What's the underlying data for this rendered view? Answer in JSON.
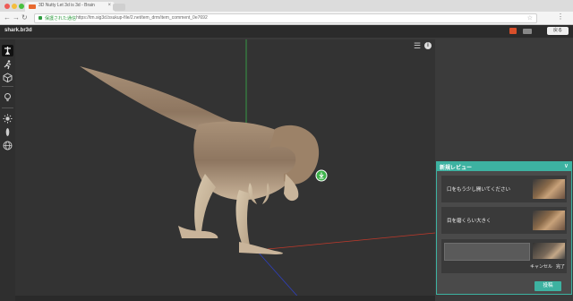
{
  "browser": {
    "tab_title": "3D Nutty Let 3d is 3d - Brain",
    "tab_close": "×",
    "secure_label": "保護された通信",
    "url": "https://tm.sig3d.bsukup-file/2.net/tem_drm/item_comment_0e7692",
    "menu_glyph": "⋮",
    "star_glyph": "☆",
    "back_glyph": "←",
    "forward_glyph": "→",
    "reload_glyph": "↻"
  },
  "app": {
    "logo": "shark.br3d",
    "header_button": "戻る"
  },
  "toolbar": {
    "icons": [
      "pose-icon",
      "run-icon",
      "cube-icon",
      "bulb-icon",
      "light-icon",
      "figure-icon",
      "globe-icon"
    ]
  },
  "viewport": {
    "layers_glyph": "☰",
    "info_glyph": "i"
  },
  "review": {
    "title": "新規レビュー",
    "collapse_glyph": "∨",
    "comments": [
      {
        "text": "口をもう少し開いてください"
      },
      {
        "text": "目を磨くらい大きく"
      }
    ],
    "cancel_label": "キャンセル",
    "done_label": "完了",
    "post_label": "投稿"
  },
  "colors": {
    "accent": "#3db2a1",
    "header_red": "#d84f2a"
  }
}
